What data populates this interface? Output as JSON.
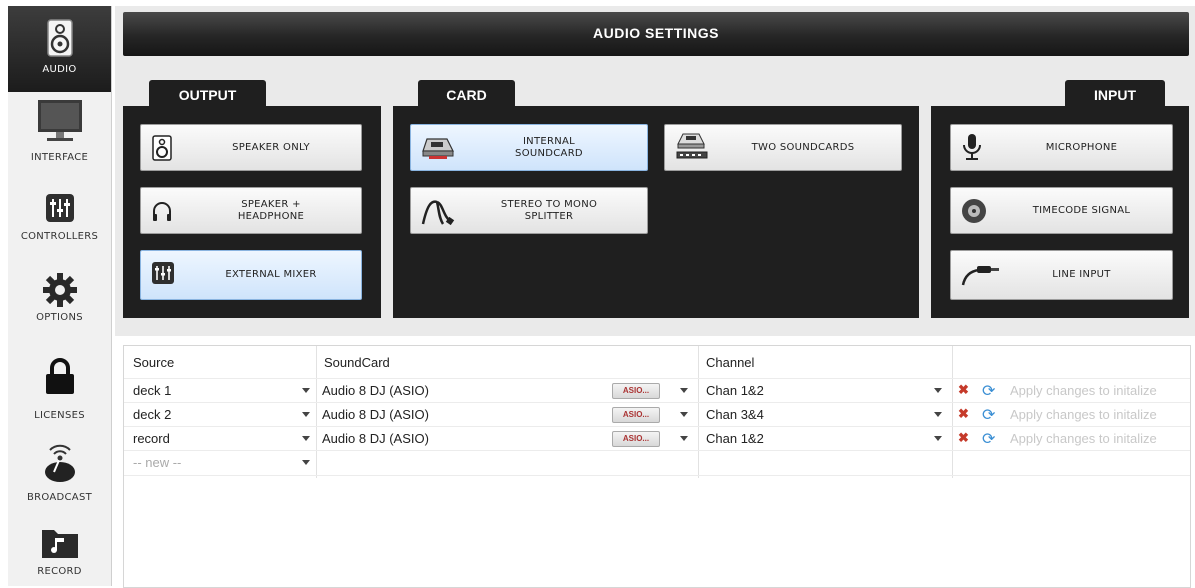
{
  "sidebar": {
    "items": [
      {
        "label": "AUDIO",
        "icon": "speaker-icon",
        "active": true
      },
      {
        "label": "INTERFACE",
        "icon": "monitor-icon"
      },
      {
        "label": "CONTROLLERS",
        "icon": "mixer-faders-icon"
      },
      {
        "label": "OPTIONS",
        "icon": "gear-icon"
      },
      {
        "label": "LICENSES",
        "icon": "lock-icon"
      },
      {
        "label": "BROADCAST",
        "icon": "broadcast-icon"
      },
      {
        "label": "RECORD",
        "icon": "folder-music-icon"
      }
    ]
  },
  "title": "AUDIO SETTINGS",
  "output": {
    "tab": "OUTPUT",
    "buttons": [
      {
        "label": "SPEAKER ONLY",
        "icon": "speaker-icon"
      },
      {
        "label": "SPEAKER +\nHEADPHONE",
        "icon": "headphone-icon"
      },
      {
        "label": "EXTERNAL MIXER",
        "icon": "mixer-faders-icon",
        "selected": true
      }
    ]
  },
  "card": {
    "tab": "CARD",
    "buttons": [
      {
        "label": "INTERNAL\nSOUNDCARD",
        "icon": "soundcard-icon",
        "selected": true
      },
      {
        "label": "TWO SOUNDCARDS",
        "icon": "two-soundcards-icon"
      },
      {
        "label": "STEREO TO MONO\nSPLITTER",
        "icon": "splitter-cable-icon"
      }
    ]
  },
  "input": {
    "tab": "INPUT",
    "buttons": [
      {
        "label": "MICROPHONE",
        "icon": "microphone-icon"
      },
      {
        "label": "TIMECODE SIGNAL",
        "icon": "vinyl-icon"
      },
      {
        "label": "LINE INPUT",
        "icon": "cable-jack-icon"
      }
    ]
  },
  "table": {
    "headers": [
      "Source",
      "SoundCard",
      "Channel"
    ],
    "rows": [
      {
        "source": "deck 1",
        "soundcard": "Audio 8 DJ (ASIO)",
        "asio": "ASIO...",
        "channel": "Chan 1&2",
        "apply": "Apply changes to initalize"
      },
      {
        "source": "deck 2",
        "soundcard": "Audio 8 DJ (ASIO)",
        "asio": "ASIO...",
        "channel": "Chan 3&4",
        "apply": "Apply changes to initalize"
      },
      {
        "source": "record",
        "soundcard": "Audio 8 DJ (ASIO)",
        "asio": "ASIO...",
        "channel": "Chan 1&2",
        "apply": "Apply changes to initalize"
      }
    ],
    "new_row": "-- new --"
  }
}
